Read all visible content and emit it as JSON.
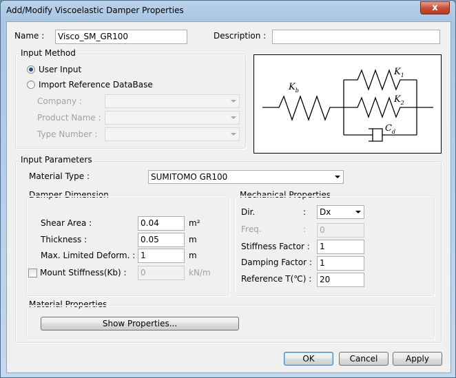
{
  "window": {
    "title": "Add/Modify Viscoelastic Damper Properties",
    "close_label": "x"
  },
  "name_field": {
    "label": "Name :",
    "value": "Visco_SM_GR100"
  },
  "description_field": {
    "label": "Description :",
    "value": ""
  },
  "input_method": {
    "title": "Input Method",
    "user_input_label": "User Input",
    "import_label": "Import Reference DataBase",
    "selected": "user_input",
    "company_label": "Company :",
    "product_name_label": "Product Name :",
    "type_number_label": "Type Number :"
  },
  "diagram": {
    "kb": "K",
    "kb_sub": "b",
    "k1": "K",
    "k1_sub": "1",
    "k2": "K",
    "k2_sub": "2",
    "cd": "C",
    "cd_sub": "d"
  },
  "input_parameters": {
    "title": "Input Parameters",
    "material_type_label": "Material Type :",
    "material_type_value": "SUMITOMO GR100"
  },
  "damper_dimension": {
    "title": "Damper Dimension",
    "shear_area": {
      "label": "Shear Area :",
      "value": "0.04",
      "unit": "m²"
    },
    "thickness": {
      "label": "Thickness :",
      "value": "0.05",
      "unit": "m"
    },
    "max_deform": {
      "label": "Max. Limited Deform. :",
      "value": "1",
      "unit": "m"
    },
    "mount_stiffness": {
      "label": "Mount Stiffness(Kb) :",
      "value": "0",
      "unit": "kN/m",
      "checked": false
    }
  },
  "mechanical_properties": {
    "title": "Mechanical Properties",
    "dir": {
      "label": "Dir.",
      "value": "Dx"
    },
    "freq": {
      "label": "Freq.",
      "value": "0"
    },
    "stiffness_factor": {
      "label": "Stiffness Factor :",
      "value": "1"
    },
    "damping_factor": {
      "label": "Damping Factor :",
      "value": "1"
    },
    "reference_temp": {
      "label": "Reference T(℃) :",
      "value": "20"
    }
  },
  "material_properties": {
    "title": "Material Properties",
    "show_button": "Show Properties..."
  },
  "footer": {
    "ok": "OK",
    "cancel": "Cancel",
    "apply": "Apply"
  }
}
